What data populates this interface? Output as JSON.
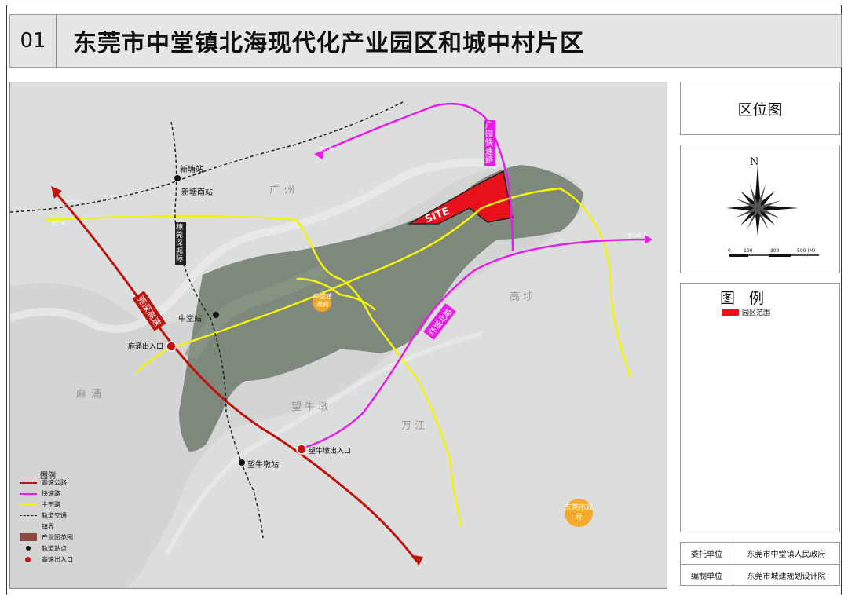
{
  "header": {
    "number": "01",
    "title": "东莞市中堂镇北海现代化产业园区和城中村片区"
  },
  "side": {
    "location_title": "区位图",
    "north": "N",
    "scale_labels": [
      "0",
      "100",
      "300",
      "500 (M)"
    ],
    "legend_title": "图 例",
    "legend_item": "园区范围"
  },
  "info": {
    "commission_key": "委托单位",
    "commission_val": "东莞市中堂镇人民政府",
    "prepared_key": "编制单位",
    "prepared_val": "东莞市城建规划设计院"
  },
  "map": {
    "site": "SITE",
    "stations": {
      "xintang": "新塘站",
      "xintang_south": "新塘南站",
      "zhongtang": "中堂站",
      "wangniudun": "望牛墩站"
    },
    "exits": {
      "machong": "麻涌出入口",
      "wangniudun": "望牛墩出入口"
    },
    "roads": {
      "guangyuan": "广园快速路",
      "huancheng": "环城北路",
      "expressway": "莞深高速",
      "rail": "穗莞深城际"
    },
    "towns": {
      "guangzhou": "广州",
      "machong": "麻涌",
      "wangniudun": "望牛墩",
      "wanjiang": "万江",
      "gaobu": "高埗",
      "zhongtang_gov": "中堂镇政府",
      "dongguan_gov": "东莞市政府"
    },
    "directions": {
      "to_guangzhou_1": "至广州",
      "to_guangzhou_2": "至广州",
      "to_guangzhou_3": "至广州",
      "to_shijie": "至石碣"
    }
  },
  "map_legend": {
    "title": "图例",
    "items": [
      "高速公路",
      "快速路",
      "主干路",
      "轨道交通",
      "镇界",
      "产业园范围",
      "轨道站点",
      "高速出入口"
    ]
  },
  "colors": {
    "site": "#e8101b",
    "expressway": "#c0140f",
    "fast_road": "#e81ee8",
    "main_road": "#f2f20a",
    "gov": "#f5a623"
  }
}
